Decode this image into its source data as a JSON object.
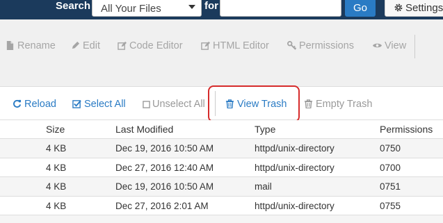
{
  "search": {
    "label": "Search",
    "scope_value": "All Your Files",
    "for_label": "for",
    "query_value": "",
    "go_label": "Go",
    "settings_label": "Settings"
  },
  "toolbar": {
    "items": [
      {
        "label": "Rename",
        "icon": "file-icon"
      },
      {
        "label": "Edit",
        "icon": "pencil-icon"
      },
      {
        "label": "Code Editor",
        "icon": "edit-icon"
      },
      {
        "label": "HTML Editor",
        "icon": "edit-icon"
      },
      {
        "label": "Permissions",
        "icon": "key-icon"
      },
      {
        "label": "View",
        "icon": "eye-icon"
      }
    ]
  },
  "actions": {
    "reload": "Reload",
    "select_all": "Select All",
    "unselect_all": "Unselect All",
    "view_trash": "View Trash",
    "empty_trash": "Empty Trash"
  },
  "table": {
    "headers": {
      "size": "Size",
      "modified": "Last Modified",
      "type": "Type",
      "permissions": "Permissions"
    },
    "rows": [
      {
        "size": "4 KB",
        "modified": "Dec 19, 2016 10:50 AM",
        "type": "httpd/unix-directory",
        "permissions": "0750"
      },
      {
        "size": "4 KB",
        "modified": "Dec 27, 2016 12:40 AM",
        "type": "httpd/unix-directory",
        "permissions": "0700"
      },
      {
        "size": "4 KB",
        "modified": "Dec 19, 2016 10:50 AM",
        "type": "mail",
        "permissions": "0751"
      },
      {
        "size": "4 KB",
        "modified": "Dec 27, 2016 2:01 AM",
        "type": "httpd/unix-directory",
        "permissions": "0755"
      }
    ]
  },
  "colors": {
    "header_bg": "#1b3a5c",
    "link_blue": "#2a7bc4",
    "highlight_red": "#d62b2b"
  }
}
